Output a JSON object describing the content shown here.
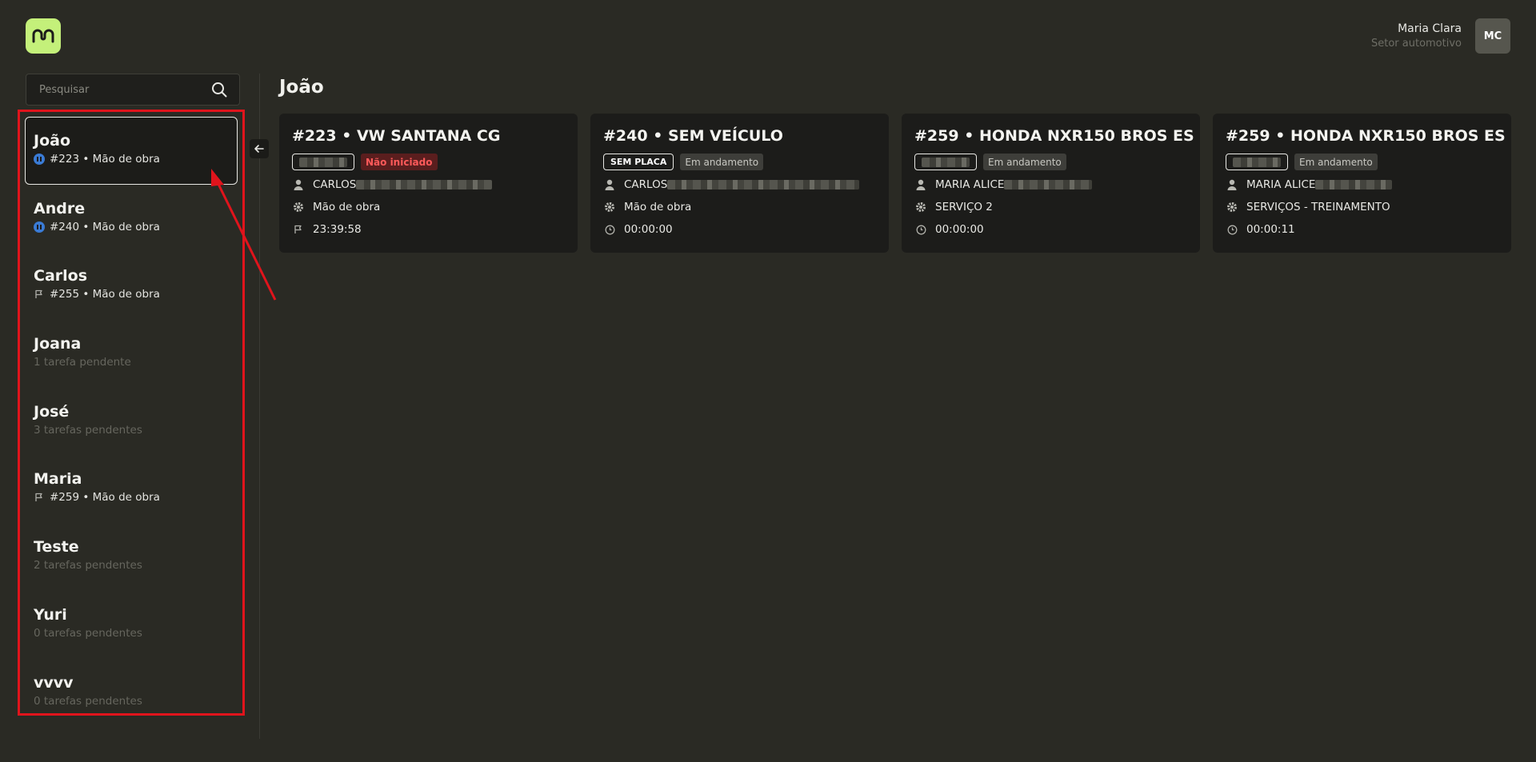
{
  "header": {
    "user_name": "Maria Clara",
    "user_role": "Setor automotivo",
    "avatar_initials": "MC"
  },
  "sidebar": {
    "search_placeholder": "Pesquisar",
    "workers": [
      {
        "name": "João",
        "sub": "#223 • Mão de obra",
        "icon": "pause-icon",
        "active": true
      },
      {
        "name": "Andre",
        "sub": "#240 • Mão de obra",
        "icon": "pause-icon",
        "active": false
      },
      {
        "name": "Carlos",
        "sub": "#255 • Mão de obra",
        "icon": "flag-icon",
        "active": false
      },
      {
        "name": "Joana",
        "sub": "1 tarefa pendente",
        "icon": "",
        "active": false
      },
      {
        "name": "José",
        "sub": "3 tarefas pendentes",
        "icon": "",
        "active": false
      },
      {
        "name": "Maria",
        "sub": "#259 • Mão de obra",
        "icon": "flag-icon",
        "active": false
      },
      {
        "name": "Teste",
        "sub": "2 tarefas pendentes",
        "icon": "",
        "active": false
      },
      {
        "name": "Yuri",
        "sub": "0 tarefas pendentes",
        "icon": "",
        "active": false
      },
      {
        "name": "vvvv",
        "sub": "0 tarefas pendentes",
        "icon": "",
        "active": false
      }
    ]
  },
  "main": {
    "title": "João",
    "cards": [
      {
        "title": "#223 • VW SANTANA CG",
        "plate": "",
        "status": "Não iniciado",
        "status_type": "not-started",
        "person": "CARLOS",
        "service": "Mão de obra",
        "time": "23:39:58",
        "time_icon": "flag-icon"
      },
      {
        "title": "#240 • SEM VEÍCULO",
        "plate": "SEM PLACA",
        "status": "Em andamento",
        "status_type": "in-progress",
        "person": "CARLOS",
        "service": "Mão de obra",
        "time": "00:00:00",
        "time_icon": "clock-icon"
      },
      {
        "title": "#259 • HONDA NXR150 BROS ES",
        "plate": "",
        "status": "Em andamento",
        "status_type": "in-progress",
        "person": "MARIA ALICE",
        "service": "SERVIÇO 2",
        "time": "00:00:00",
        "time_icon": "clock-icon"
      },
      {
        "title": "#259 • HONDA NXR150 BROS ES",
        "plate": "",
        "status": "Em andamento",
        "status_type": "in-progress",
        "person": "MARIA ALICE",
        "service": "SERVIÇOS - TREINAMENTO",
        "time": "00:00:11",
        "time_icon": "clock-icon"
      }
    ]
  },
  "colors": {
    "background": "#2a2a24",
    "accent": "#c4f07a",
    "highlight": "#e0141c",
    "pause_blue": "#3a7bd5"
  }
}
